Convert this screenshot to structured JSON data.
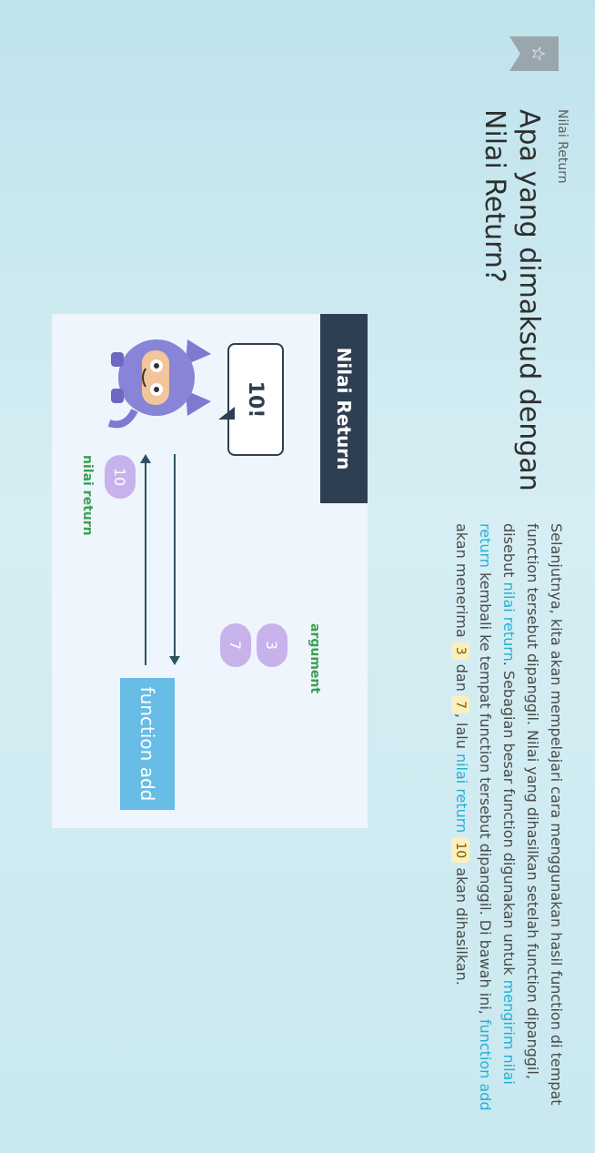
{
  "breadcrumb": "Nilai Return",
  "title": "Apa yang dimaksud dengan Nilai Return?",
  "paragraph": {
    "t1": "Selanjutnya, kita akan mempelajari cara menggunakan hasil function di tempat function tersebut dipanggil. Nilai yang dihasilkan setelah function dipanggil, disebut ",
    "h1": "nilai return",
    "t2": ". Sebagian besar function digunakan untuk ",
    "h2": "mengirim nilai return",
    "t3": " kembali ke tempat function tersebut dipanggil. Di bawah ini, ",
    "h3": "function add",
    "t4": " akan menerima ",
    "n1": "3",
    "t5": " dan ",
    "n2": "7",
    "t6": ", lalu ",
    "h4": "nilai return",
    "t7": " ",
    "n3": "10",
    "t8": " akan dihasilkan."
  },
  "diagram": {
    "header": "Nilai Return",
    "speech": "10!",
    "function_label": "function add",
    "argument_label": "argument",
    "arguments": [
      "3",
      "7"
    ],
    "return_value": "10",
    "return_label": "nilai return"
  },
  "colors": {
    "accent": "#22b0d6",
    "header_bg": "#2f3f52",
    "function_bg": "#67bde5",
    "pill_bg": "#c8b2ec",
    "label_green": "#3aa152"
  }
}
